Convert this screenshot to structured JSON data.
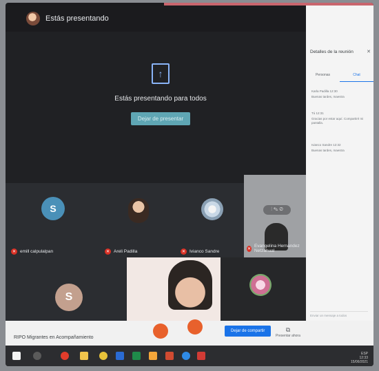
{
  "header": {
    "title": "Estás presentando"
  },
  "presenting": {
    "message": "Estás presentando para todos",
    "stop_label": "Dejar de presentar"
  },
  "participants": [
    {
      "name": "emill calpulalpan",
      "initial": "S"
    },
    {
      "name": "Areli Padilla"
    },
    {
      "name": "Ivianco Sandre"
    },
    {
      "name": "Evangelina Hernandez Netzahual"
    },
    {
      "initial": "S"
    }
  ],
  "panel": {
    "title": "Detalles de la reunión",
    "tabs": [
      "Personas",
      "Chat"
    ],
    "messages": [
      "Karla Padilla   12:30",
      "Buenas tardes, maestra",
      "Tú   12:31",
      "Gracias por estar aquí. Compartiré mi pantalla.",
      "Ivianco Sandre   12:32",
      "Buenas tardes, maestra"
    ],
    "input_placeholder": "Enviar un mensaje a todos"
  },
  "bottom": {
    "meeting_name": "RIPO Migrantes en Acompañamiento",
    "share_label": "Dejar de compartir",
    "present_label": "Presentar ahora"
  },
  "tray": {
    "lang": "ESP",
    "time": "12:33",
    "date": "15/06/2021"
  }
}
